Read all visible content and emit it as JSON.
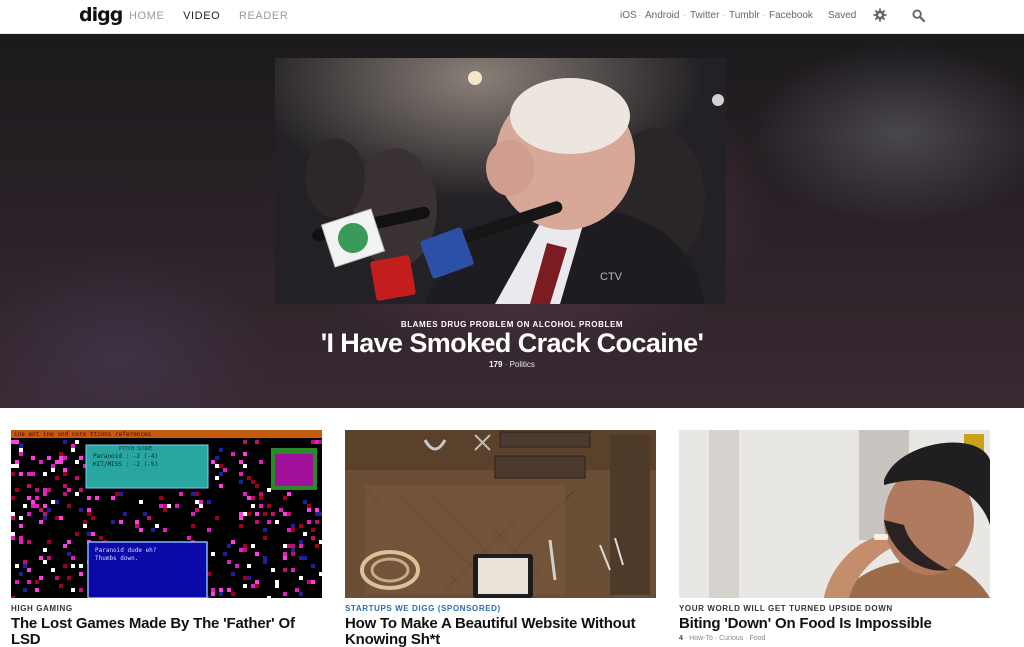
{
  "nav": {
    "logo": "digg",
    "links": [
      "HOME",
      "VIDEO",
      "READER"
    ],
    "active": "VIDEO",
    "right_links": [
      "iOS",
      "Android",
      "Twitter",
      "Tumblr",
      "Facebook"
    ],
    "saved": "Saved",
    "icons": [
      "gear-icon",
      "search-icon"
    ]
  },
  "hero": {
    "kicker": "BLAMES DRUG PROBLEM ON ALCOHOL PROBLEM",
    "title": "'I Have Smoked Crack Cocaine'",
    "count": "179",
    "category": "Politics",
    "watermark": "CTV"
  },
  "cards": [
    {
      "kicker": "HIGH GAMING",
      "title": "The Lost Games Made By The 'Father' Of LSD",
      "game": {
        "menu": "ine  ent  ine  und  core  ttions  references",
        "score_title": "PITCH SCORE",
        "score_line1": "Paranoid    : -2  (-4)",
        "score_line2": "HIT/MISS    : -2  (-5)",
        "dialog_line1": "Paranoid dude eh?",
        "dialog_line2": "Thumbs down."
      }
    },
    {
      "kicker": "STARTUPS WE DIGG (SPONSORED)",
      "title": "How To Make A Beautiful Website Without Knowing Sh*t"
    },
    {
      "kicker": "YOUR WORLD WILL GET TURNED UPSIDE DOWN",
      "title": "Biting 'Down' On Food Is Impossible",
      "count": "4",
      "tags": [
        "How-To",
        "Curious",
        "Food"
      ]
    }
  ],
  "colors": {
    "accent_blue": "#2a6bb0",
    "hero_bg": "#2b2228"
  }
}
